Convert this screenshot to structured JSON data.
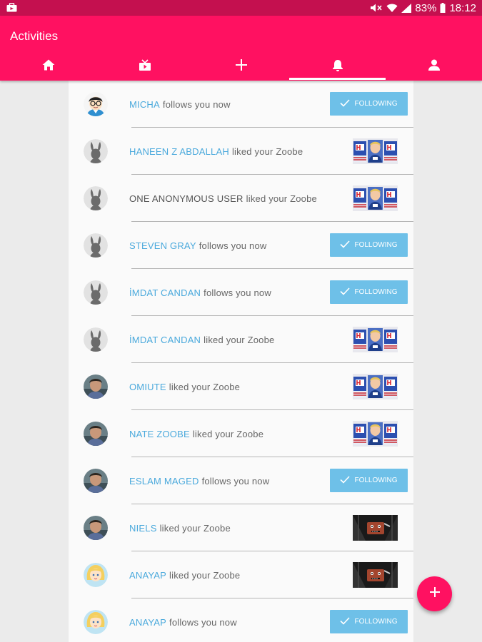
{
  "status_bar": {
    "battery": "83%",
    "time": "18:12"
  },
  "app": {
    "title": "Activities"
  },
  "tabs": [
    {
      "icon": "home-icon"
    },
    {
      "icon": "tv-icon"
    },
    {
      "icon": "plus-icon"
    },
    {
      "icon": "bell-icon",
      "active": true
    },
    {
      "icon": "person-icon"
    }
  ],
  "follow_label": "FOLLOWING",
  "activities": [
    {
      "user": "MICHA",
      "action": "follows you now",
      "avatar": "nerd-avatar",
      "type": "follow"
    },
    {
      "user": "HANEEN Z ABDALLAH",
      "action": "liked your Zoobe",
      "avatar": "bunny-avatar",
      "type": "like",
      "thumb": "zoobe-character-thumbnail"
    },
    {
      "user": "ONE ANONYMOUS USER",
      "action": "liked your Zoobe",
      "avatar": "bunny-avatar",
      "type": "like",
      "thumb": "zoobe-character-thumbnail",
      "anonymous": true
    },
    {
      "user": "STEVEN GRAY",
      "action": "follows you now",
      "avatar": "bunny-avatar",
      "type": "follow"
    },
    {
      "user": "İMDAT CANDAN",
      "action": "follows you now",
      "avatar": "bunny-avatar",
      "type": "follow"
    },
    {
      "user": "İMDAT CANDAN",
      "action": "liked your Zoobe",
      "avatar": "bunny-avatar",
      "type": "like",
      "thumb": "zoobe-character-thumbnail"
    },
    {
      "user": "OMIUTE",
      "action": "liked your Zoobe",
      "avatar": "photo-avatar",
      "type": "like",
      "thumb": "zoobe-character-thumbnail"
    },
    {
      "user": "NATE ZOOBE",
      "action": "liked your Zoobe",
      "avatar": "photo-avatar",
      "type": "like",
      "thumb": "zoobe-character-thumbnail"
    },
    {
      "user": "ESLAM MAGED",
      "action": "follows you now",
      "avatar": "photo-avatar",
      "type": "follow"
    },
    {
      "user": "NIELS",
      "action": "liked your Zoobe",
      "avatar": "photo-avatar",
      "type": "like",
      "thumb": "zoobe-dark-thumbnail"
    },
    {
      "user": "ANAYAP",
      "action": "liked your Zoobe",
      "avatar": "cartoon-girl-avatar",
      "type": "like",
      "thumb": "zoobe-dark-thumbnail"
    },
    {
      "user": "ANAYAP",
      "action": "follows you now",
      "avatar": "cartoon-girl-avatar",
      "type": "follow"
    }
  ],
  "colors": {
    "accent": "#ff1161",
    "status_bar": "#c4104f",
    "link": "#4aa9dc",
    "follow_button": "#6ec0e8"
  }
}
